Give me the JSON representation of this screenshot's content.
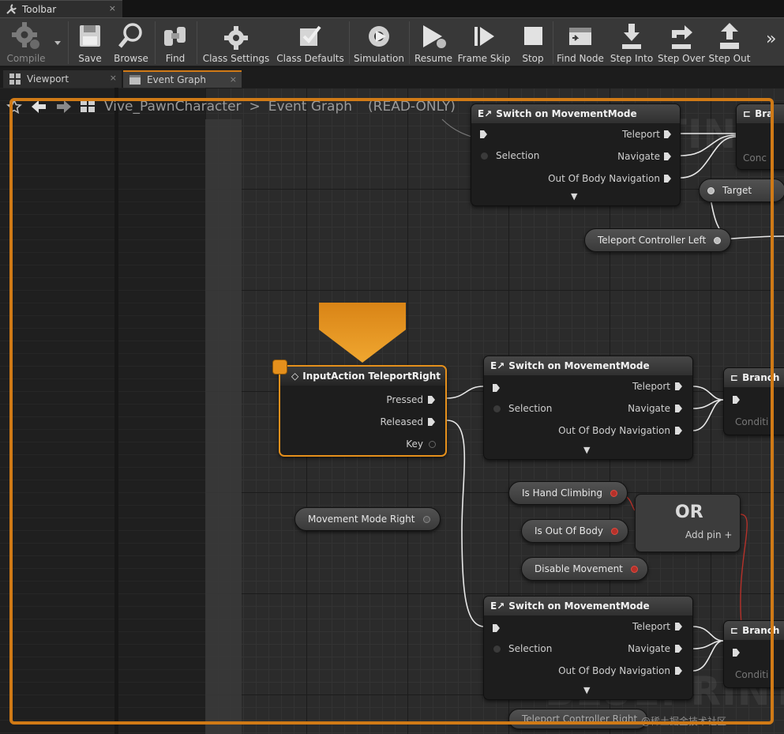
{
  "top_tab": {
    "label": "Toolbar",
    "close": "×"
  },
  "toolbar": {
    "buttons": [
      {
        "label": "Compile",
        "icon": "gear-compile-icon"
      },
      {
        "label": "Save",
        "icon": "floppy-disk-icon"
      },
      {
        "label": "Browse",
        "icon": "magnifier-icon"
      },
      {
        "label": "Find",
        "icon": "binoculars-icon"
      },
      {
        "label": "Class Settings",
        "icon": "class-settings-icon"
      },
      {
        "label": "Class Defaults",
        "icon": "class-defaults-icon"
      },
      {
        "label": "Simulation",
        "icon": "simulation-icon"
      },
      {
        "label": "Resume",
        "icon": "resume-icon"
      },
      {
        "label": "Frame Skip",
        "icon": "frame-skip-icon"
      },
      {
        "label": "Stop",
        "icon": "stop-icon"
      },
      {
        "label": "Find Node",
        "icon": "find-node-icon"
      },
      {
        "label": "Step Into",
        "icon": "step-into-icon"
      },
      {
        "label": "Step Over",
        "icon": "step-over-icon"
      },
      {
        "label": "Step Out",
        "icon": "step-out-icon"
      }
    ],
    "overflow": "»"
  },
  "doc_tabs": [
    {
      "label": "Viewport",
      "close": "×"
    },
    {
      "label": "Event Graph",
      "close": "×"
    }
  ],
  "breadcrumb": {
    "blueprint": "Vive_PawnCharacter",
    "separator": ">",
    "graph": "Event Graph",
    "mode": "(READ-ONLY)"
  },
  "watermarks": {
    "top": "SIMULATING",
    "bottom": "BLUEPRINT"
  },
  "nodes": {
    "switch_top": {
      "title": "Switch on MovementMode",
      "pins": {
        "teleport": "Teleport",
        "selection": "Selection",
        "navigate": "Navigate",
        "out_of_body": "Out Of Body Navigation"
      }
    },
    "branch_top": {
      "title": "Bra",
      "condition": "Conc"
    },
    "target_var": {
      "label": "Target"
    },
    "teleport_controller_left": {
      "label": "Teleport Controller Left"
    },
    "input_action": {
      "title": "InputAction TeleportRight",
      "pins": {
        "pressed": "Pressed",
        "released": "Released",
        "key": "Key"
      }
    },
    "switch_mid": {
      "title": "Switch on MovementMode",
      "pins": {
        "teleport": "Teleport",
        "selection": "Selection",
        "navigate": "Navigate",
        "out_of_body": "Out Of Body Navigation"
      }
    },
    "branch_mid": {
      "title": "Branch",
      "condition": "Conditi"
    },
    "is_hand_climbing": {
      "label": "Is Hand Climbing"
    },
    "is_out_of_body": {
      "label": "Is Out Of Body"
    },
    "disable_movement": {
      "label": "Disable Movement"
    },
    "or_node": {
      "title": "OR",
      "add_pin": "Add pin +"
    },
    "movement_mode_right": {
      "label": "Movement Mode Right"
    },
    "switch_bottom": {
      "title": "Switch on MovementMode",
      "pins": {
        "teleport": "Teleport",
        "selection": "Selection",
        "navigate": "Navigate",
        "out_of_body": "Out Of Body Navigation"
      }
    },
    "branch_bottom": {
      "title": "Branch",
      "condition": "Conditi"
    },
    "teleport_controller_right_partial": {
      "label": "Teleport Controller Right"
    }
  },
  "corner_watermark": "@稀土掘金技术社区",
  "colors": {
    "accent_orange": "#e5901c",
    "read_only_frame": "#d07a16",
    "graph_bg": "#2b2b2b"
  }
}
